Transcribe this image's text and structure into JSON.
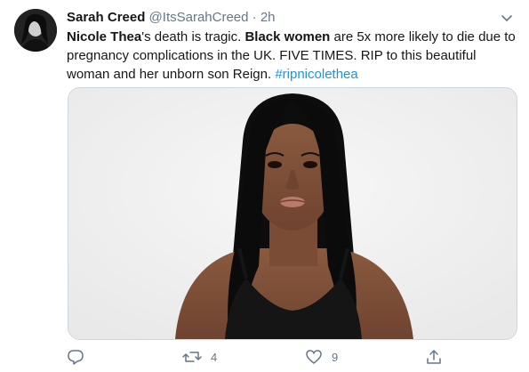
{
  "tweet": {
    "author": {
      "name": "Sarah Creed",
      "handle": "@ItsSarahCreed",
      "separator": "·",
      "time": "2h",
      "avatar_icon": "profile-avatar"
    },
    "text": {
      "segment1_bold": "Nicole Thea",
      "segment2": "'s death is tragic. ",
      "segment3_bold": "Black women",
      "segment4": " are 5x more likely to die due to pregnancy complications in the UK. FIVE TIMES. RIP to this beautiful woman and her unborn son Reign. ",
      "hashtag": "#ripnicolethea"
    },
    "media": {
      "description_icon": "photo-portrait"
    },
    "actions": {
      "reply": {
        "icon": "reply-icon",
        "count": ""
      },
      "retweet": {
        "icon": "retweet-icon",
        "count": "4"
      },
      "like": {
        "icon": "heart-icon",
        "count": "9"
      },
      "share": {
        "icon": "share-icon",
        "count": ""
      }
    },
    "colors": {
      "link": "#1b95e0",
      "secondary": "#657786",
      "text": "#14171a",
      "border": "#ccd6dd"
    }
  }
}
